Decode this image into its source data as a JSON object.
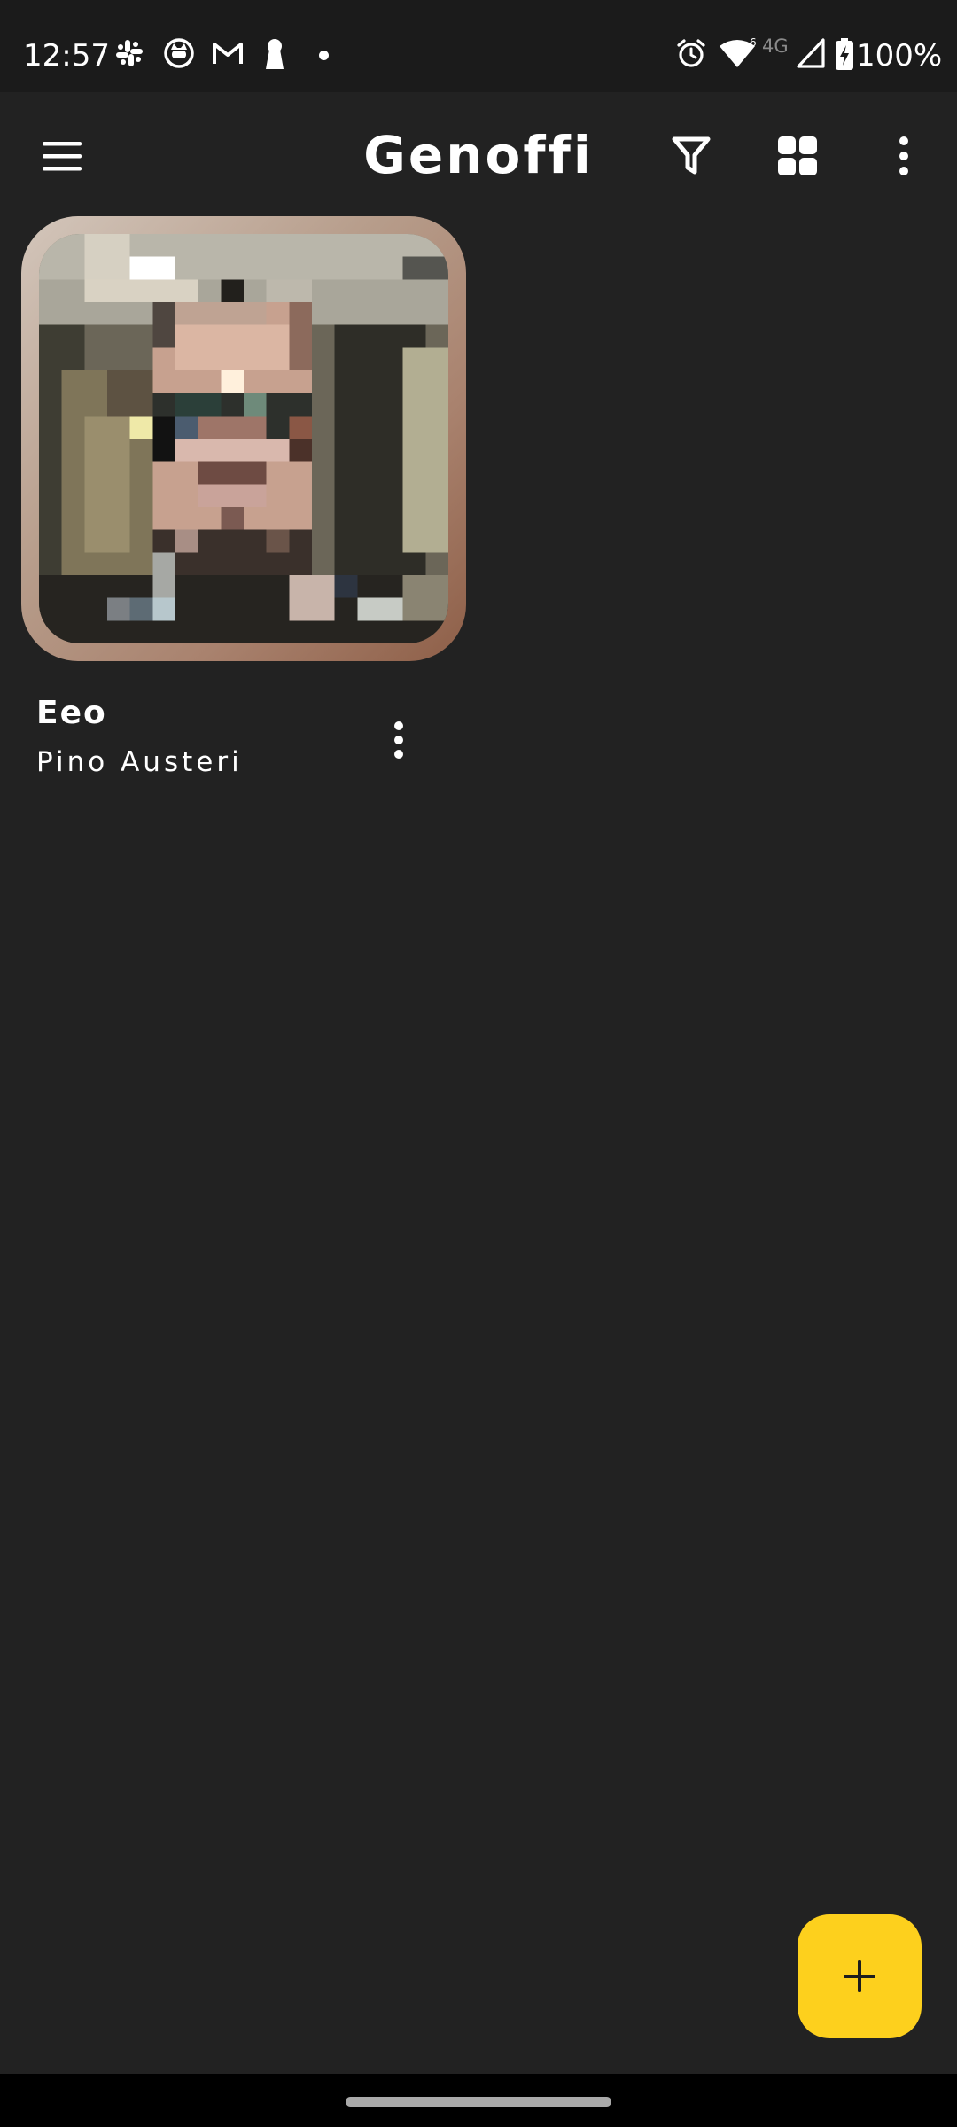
{
  "status_bar": {
    "time": "12:57",
    "network_type": "4G",
    "battery_percent": "100%",
    "notification_icons": [
      "slack-icon",
      "cat-app-icon",
      "gmail-icon",
      "keyhole-icon",
      "dot-icon"
    ],
    "system_icons": [
      "alarm-icon",
      "wifi-icon",
      "signal-icon",
      "battery-charging-icon"
    ]
  },
  "toolbar": {
    "title": "Genoffi",
    "icons": [
      "menu-icon",
      "filter-icon",
      "grid-view-icon",
      "more-vertical-icon"
    ]
  },
  "items": [
    {
      "title": "Eeo",
      "subtitle": "Pino Austeri",
      "menu_icon": "more-vertical-icon"
    }
  ],
  "fab": {
    "icon": "plus-icon",
    "color": "#fdd01d"
  },
  "colors": {
    "background": "#222222",
    "status_bar": "#1b1b1b",
    "accent": "#fdd01d"
  }
}
